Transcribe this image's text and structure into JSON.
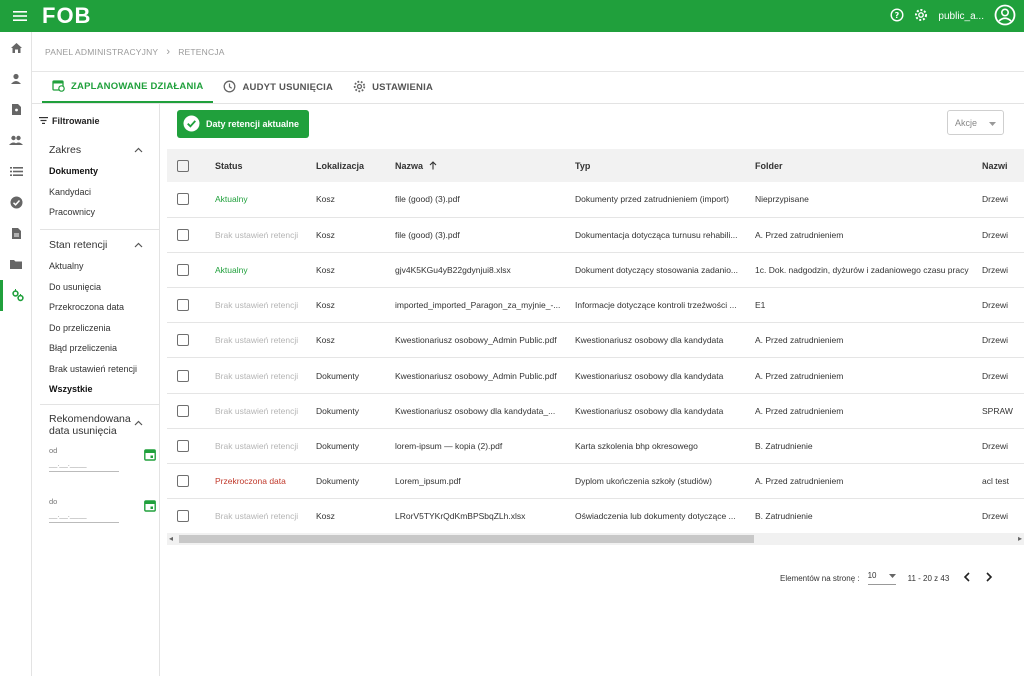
{
  "app": {
    "logo": "FOB",
    "username": "public_a..."
  },
  "breadcrumb": [
    "PANEL ADMINISTRACYJNY",
    "RETENCJA"
  ],
  "tabs": [
    {
      "label": "ZAPLANOWANE DZIAŁANIA",
      "active": true
    },
    {
      "label": "AUDYT USUNIĘCIA",
      "active": false
    },
    {
      "label": "USTAWIENIA",
      "active": false
    }
  ],
  "filters": {
    "title": "Filtrowanie",
    "scope": {
      "label": "Zakres",
      "items": [
        "Dokumenty",
        "Kandydaci",
        "Pracownicy"
      ]
    },
    "retention": {
      "label": "Stan retencji",
      "items": [
        "Aktualny",
        "Do usunięcia",
        "Przekroczona data",
        "Do przeliczenia",
        "Błąd przeliczenia",
        "Brak ustawień retencji",
        "Wszystkie"
      ]
    },
    "recommended": {
      "label": "Rekomendowana data usunięcia",
      "from_label": "od",
      "to_label": "do",
      "placeholder": "__.__.____"
    }
  },
  "toolbar": {
    "status_button": "Daty retencji aktualne",
    "actions_label": "Akcje"
  },
  "table": {
    "headers": [
      "Status",
      "Lokalizacja",
      "Nazwa",
      "Typ",
      "Folder",
      "Nazwi"
    ],
    "rows": [
      [
        "Aktualny",
        "Kosz",
        "file (good) (3).pdf",
        "Dokumenty przed zatrudnieniem (import)",
        "Nieprzypisane",
        "Drzewi"
      ],
      [
        "Brak ustawień retencji",
        "Kosz",
        "file (good) (3).pdf",
        "Dokumentacja dotycząca turnusu rehabili...",
        "A. Przed zatrudnieniem",
        "Drzewi"
      ],
      [
        "Aktualny",
        "Kosz",
        "gjv4K5KGu4yB22gdynjui8.xlsx",
        "Dokument dotyczący stosowania zadanio...",
        "1c. Dok. nadgodzin, dyżurów i zadaniowego czasu pracy",
        "Drzewi"
      ],
      [
        "Brak ustawień retencji",
        "Kosz",
        "imported_imported_Paragon_za_myjnie_-...",
        "Informacje dotyczące kontroli trzeźwości ...",
        "E1",
        "Drzewi"
      ],
      [
        "Brak ustawień retencji",
        "Kosz",
        "Kwestionariusz osobowy_Admin Public.pdf",
        "Kwestionariusz osobowy dla kandydata",
        "A. Przed zatrudnieniem",
        "Drzewi"
      ],
      [
        "Brak ustawień retencji",
        "Dokumenty",
        "Kwestionariusz osobowy_Admin Public.pdf",
        "Kwestionariusz osobowy dla kandydata",
        "A. Przed zatrudnieniem",
        "Drzewi"
      ],
      [
        "Brak ustawień retencji",
        "Dokumenty",
        "Kwestionariusz osobowy dla kandydata_...",
        "Kwestionariusz osobowy dla kandydata",
        "A. Przed zatrudnieniem",
        "SPRAW"
      ],
      [
        "Brak ustawień retencji",
        "Dokumenty",
        "lorem-ipsum — kopia (2).pdf",
        "Karta szkolenia bhp okresowego",
        "B. Zatrudnienie",
        "Drzewi"
      ],
      [
        "Przekroczona data",
        "Dokumenty",
        "Lorem_ipsum.pdf",
        "Dyplom ukończenia szkoły (studiów)",
        "A. Przed zatrudnieniem",
        "acl test"
      ],
      [
        "Brak ustawień retencji",
        "Kosz",
        "LRorV5TYKrQdKmBPSbqZLh.xlsx",
        "Oświadczenia lub dokumenty dotyczące ...",
        "B. Zatrudnienie",
        "Drzewi"
      ]
    ],
    "status_kinds": [
      "ok",
      "none",
      "ok",
      "none",
      "none",
      "none",
      "none",
      "none",
      "over",
      "none"
    ]
  },
  "pagination": {
    "label": "Elementów na stronę :",
    "page_size": "10",
    "range": "11 - 20 z 43"
  },
  "colors": {
    "brand": "#20a03c",
    "overdue": "#c0392b",
    "muted": "#b5b5b5"
  }
}
